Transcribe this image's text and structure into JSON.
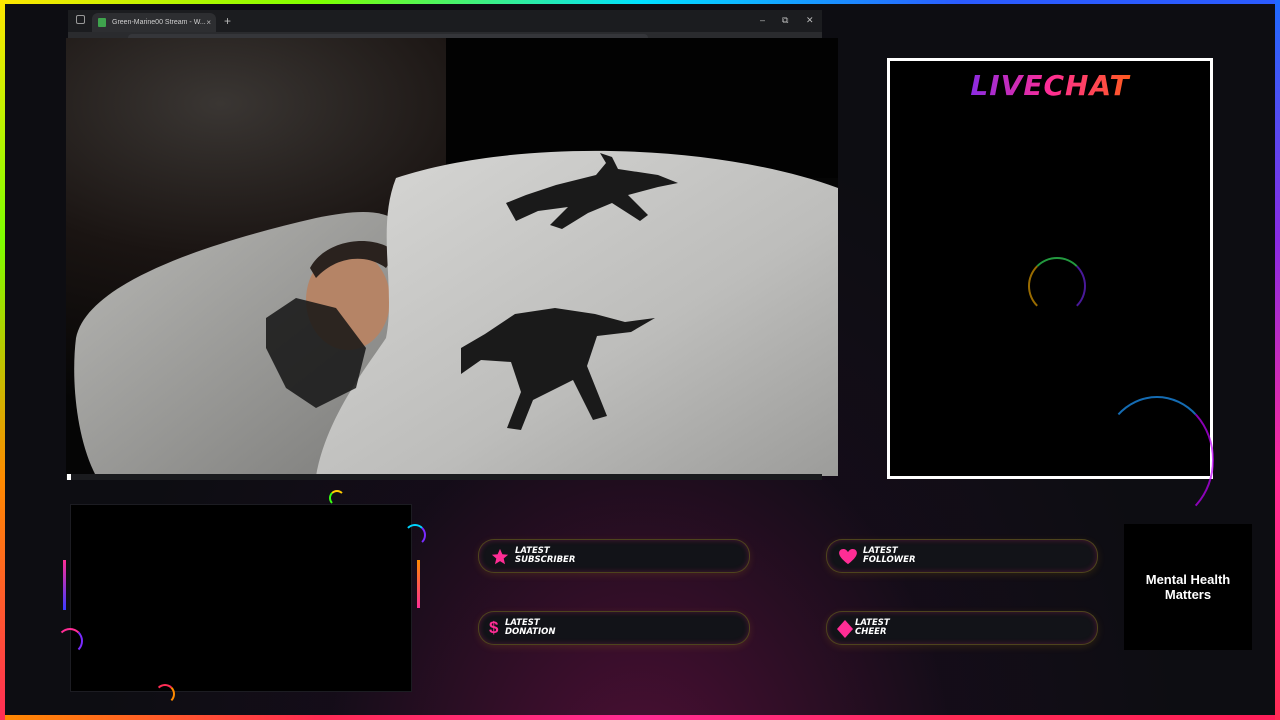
{
  "browser": {
    "tab_title": "Green-Marine00 Stream - W...",
    "tab_close": "×",
    "new_tab": "+",
    "window_controls": {
      "minimize": "–",
      "restore": "⧉",
      "close": "✕"
    }
  },
  "video": {
    "description_icon": "webcam-feed"
  },
  "livechat": {
    "title": "LIVECHAT"
  },
  "alerts": {
    "subscriber": {
      "label_line1": "LATEST",
      "label_line2": "SUBSCRIBER",
      "icon": "star-icon",
      "value": ""
    },
    "follower": {
      "label_line1": "LATEST",
      "label_line2": "FOLLOWER",
      "icon": "heart-icon",
      "value": ""
    },
    "donation": {
      "label_line1": "LATEST",
      "label_line2": "DONATION",
      "icon": "dollar-icon",
      "value": ""
    },
    "cheer": {
      "label_line1": "LATEST",
      "label_line2": "CHEER",
      "icon": "diamond-icon",
      "value": ""
    }
  },
  "mental_health": {
    "line1": "Mental Health",
    "line2": "Matters"
  },
  "colors": {
    "accent_pink": "#ff2d95",
    "accent_gold": "#d4a017",
    "chat_border": "#ffffff"
  }
}
